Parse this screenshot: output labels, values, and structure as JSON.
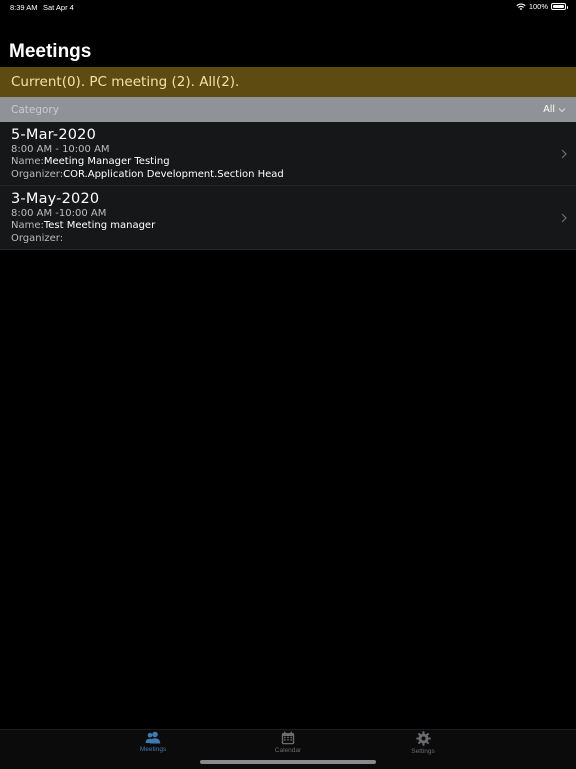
{
  "status_bar": {
    "time": "8:39 AM",
    "date": "Sat Apr 4",
    "battery": "100%"
  },
  "page": {
    "title": "Meetings"
  },
  "summary": {
    "text": "Current(0). PC meeting (2). All(2)."
  },
  "category": {
    "label": "Category",
    "selected": "All"
  },
  "labels": {
    "name": "Name:",
    "organizer": "Organizer:"
  },
  "meetings": [
    {
      "date": "5-Mar-2020",
      "time": "8:00 AM - 10:00 AM",
      "name": "Meeting Manager Testing",
      "organizer": "COR.Application Development.Section Head"
    },
    {
      "date": "3-May-2020",
      "time": "8:00 AM -10:00 AM",
      "name": "Test Meeting manager",
      "organizer": ""
    }
  ],
  "tabs": [
    {
      "label": "Meetings",
      "icon": "people-icon",
      "active": true
    },
    {
      "label": "Calendar",
      "icon": "calendar-icon",
      "active": false
    },
    {
      "label": "Settings",
      "icon": "gear-icon",
      "active": false
    }
  ],
  "colors": {
    "background": "#000000",
    "summary_bar": "#5e4b12",
    "summary_text": "#f2e2a8",
    "category_bar": "#8f9296",
    "row_background": "#161718",
    "tab_active": "#3d7ab0",
    "tab_inactive": "#6b6b6f"
  }
}
